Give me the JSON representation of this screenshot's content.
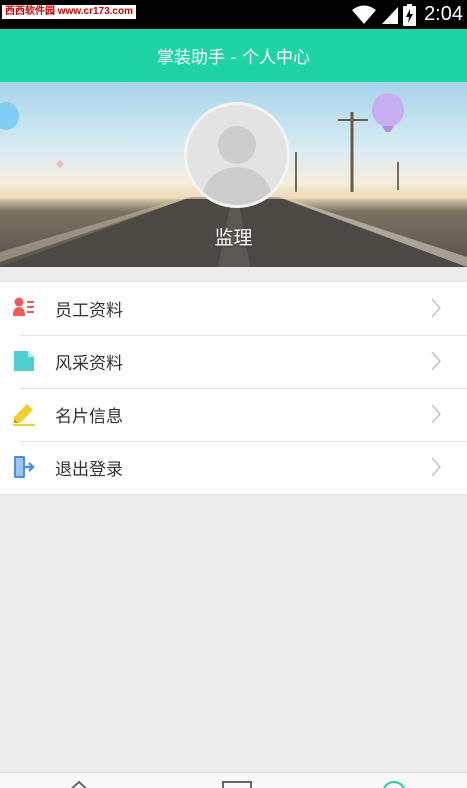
{
  "status_bar": {
    "watermark": "西西软件园 www.cr173.com",
    "time": "2:04",
    "icons": [
      "wifi-icon",
      "signal-icon",
      "battery-charging-icon"
    ]
  },
  "header": {
    "title": "掌装助手 - 个人中心"
  },
  "profile": {
    "role": "监理",
    "avatar_icon": "default-avatar-icon"
  },
  "menu": {
    "items": [
      {
        "label": "员工资料",
        "icon": "employee-card-icon",
        "color": "#f05a5a"
      },
      {
        "label": "风采资料",
        "icon": "document-icon",
        "color": "#4fcfcf"
      },
      {
        "label": "名片信息",
        "icon": "pencil-icon",
        "color": "#f2cf2a"
      },
      {
        "label": "退出登录",
        "icon": "logout-icon",
        "color": "#4a90e2"
      }
    ]
  },
  "colors": {
    "accent": "#1fd4a4",
    "background": "#ececec"
  },
  "bottom_nav": {
    "items": [
      "home-icon",
      "card-icon",
      "profile-icon"
    ]
  }
}
